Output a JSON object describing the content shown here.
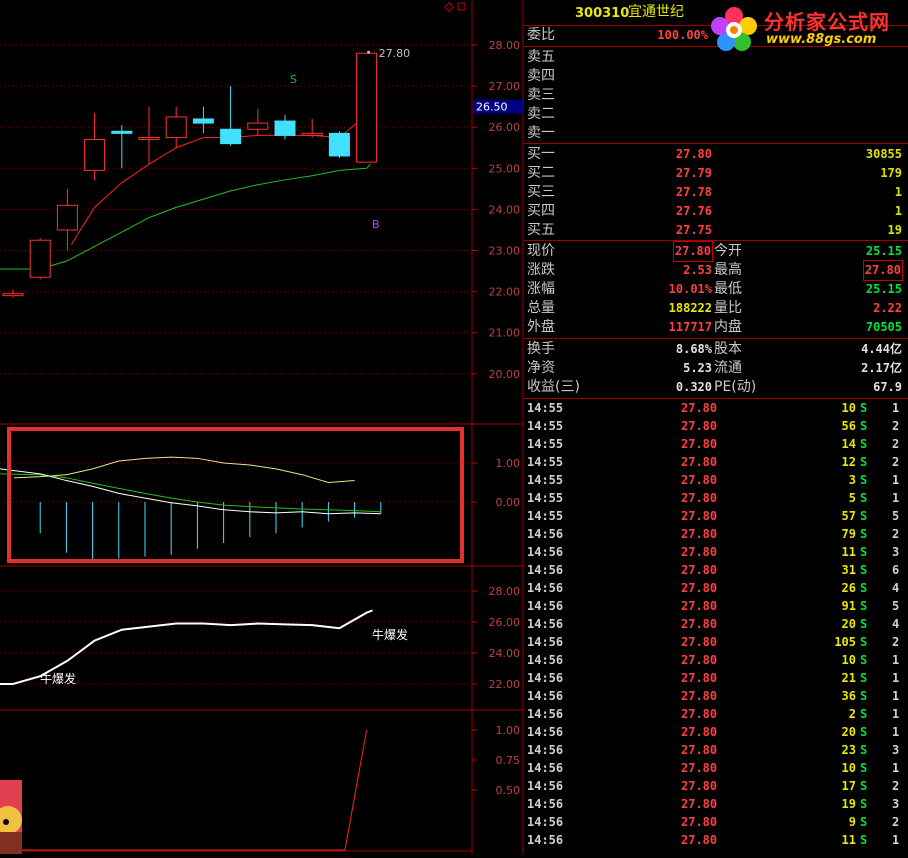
{
  "header": {
    "stock_code": "300310",
    "stock_name": "宜通世纪"
  },
  "logo": {
    "brand": "分析家公式网",
    "url": "www.88gs.com"
  },
  "weibi": {
    "label": "委比",
    "value": "100.00%"
  },
  "sell_orders": [
    {
      "label": "卖五",
      "price": "",
      "vol": ""
    },
    {
      "label": "卖四",
      "price": "",
      "vol": ""
    },
    {
      "label": "卖三",
      "price": "",
      "vol": ""
    },
    {
      "label": "卖二",
      "price": "",
      "vol": ""
    },
    {
      "label": "卖一",
      "price": "",
      "vol": ""
    }
  ],
  "buy_orders": [
    {
      "label": "买一",
      "price": "27.80",
      "vol": "30855"
    },
    {
      "label": "买二",
      "price": "27.79",
      "vol": "179"
    },
    {
      "label": "买三",
      "price": "27.78",
      "vol": "1"
    },
    {
      "label": "买四",
      "price": "27.76",
      "vol": "1"
    },
    {
      "label": "买五",
      "price": "27.75",
      "vol": "19"
    }
  ],
  "stats": [
    {
      "l1": "现价",
      "v1": "27.80",
      "c1": "red",
      "b1": true,
      "l2": "今开",
      "v2": "25.15",
      "c2": "green",
      "b2": false
    },
    {
      "l1": "涨跌",
      "v1": "2.53",
      "c1": "red",
      "b1": false,
      "l2": "最高",
      "v2": "27.80",
      "c2": "red",
      "b2": true
    },
    {
      "l1": "涨幅",
      "v1": "10.01%",
      "c1": "red",
      "b1": false,
      "l2": "最低",
      "v2": "25.15",
      "c2": "green",
      "b2": false
    },
    {
      "l1": "总量",
      "v1": "188222",
      "c1": "yellow",
      "b1": false,
      "l2": "量比",
      "v2": "2.22",
      "c2": "red",
      "b2": false
    },
    {
      "l1": "外盘",
      "v1": "117717",
      "c1": "red",
      "b1": false,
      "l2": "内盘",
      "v2": "70505",
      "c2": "green",
      "b2": false
    }
  ],
  "stats2": [
    {
      "l1": "换手",
      "v1": "8.68%",
      "l2": "股本",
      "v2": "4.44亿"
    },
    {
      "l1": "净资",
      "v1": "5.23",
      "l2": "流通",
      "v2": "2.17亿"
    },
    {
      "l1": "收益(三)",
      "v1": "0.320",
      "l2": "PE(动)",
      "v2": "67.9"
    }
  ],
  "ticks": [
    {
      "time": "14:55",
      "price": "27.80",
      "vol": "10",
      "side": "S",
      "cnt": "1"
    },
    {
      "time": "14:55",
      "price": "27.80",
      "vol": "56",
      "side": "S",
      "cnt": "2"
    },
    {
      "time": "14:55",
      "price": "27.80",
      "vol": "14",
      "side": "S",
      "cnt": "2"
    },
    {
      "time": "14:55",
      "price": "27.80",
      "vol": "12",
      "side": "S",
      "cnt": "2"
    },
    {
      "time": "14:55",
      "price": "27.80",
      "vol": "3",
      "side": "S",
      "cnt": "1"
    },
    {
      "time": "14:55",
      "price": "27.80",
      "vol": "5",
      "side": "S",
      "cnt": "1"
    },
    {
      "time": "14:55",
      "price": "27.80",
      "vol": "57",
      "side": "S",
      "cnt": "5"
    },
    {
      "time": "14:56",
      "price": "27.80",
      "vol": "79",
      "side": "S",
      "cnt": "2"
    },
    {
      "time": "14:56",
      "price": "27.80",
      "vol": "11",
      "side": "S",
      "cnt": "3"
    },
    {
      "time": "14:56",
      "price": "27.80",
      "vol": "31",
      "side": "S",
      "cnt": "6"
    },
    {
      "time": "14:56",
      "price": "27.80",
      "vol": "26",
      "side": "S",
      "cnt": "4"
    },
    {
      "time": "14:56",
      "price": "27.80",
      "vol": "91",
      "side": "S",
      "cnt": "5"
    },
    {
      "time": "14:56",
      "price": "27.80",
      "vol": "20",
      "side": "S",
      "cnt": "4"
    },
    {
      "time": "14:56",
      "price": "27.80",
      "vol": "105",
      "side": "S",
      "cnt": "2"
    },
    {
      "time": "14:56",
      "price": "27.80",
      "vol": "10",
      "side": "S",
      "cnt": "1"
    },
    {
      "time": "14:56",
      "price": "27.80",
      "vol": "21",
      "side": "S",
      "cnt": "1"
    },
    {
      "time": "14:56",
      "price": "27.80",
      "vol": "36",
      "side": "S",
      "cnt": "1"
    },
    {
      "time": "14:56",
      "price": "27.80",
      "vol": "2",
      "side": "S",
      "cnt": "1"
    },
    {
      "time": "14:56",
      "price": "27.80",
      "vol": "20",
      "side": "S",
      "cnt": "1"
    },
    {
      "time": "14:56",
      "price": "27.80",
      "vol": "23",
      "side": "S",
      "cnt": "3"
    },
    {
      "time": "14:56",
      "price": "27.80",
      "vol": "10",
      "side": "S",
      "cnt": "1"
    },
    {
      "time": "14:56",
      "price": "27.80",
      "vol": "17",
      "side": "S",
      "cnt": "2"
    },
    {
      "time": "14:56",
      "price": "27.80",
      "vol": "19",
      "side": "S",
      "cnt": "3"
    },
    {
      "time": "14:56",
      "price": "27.80",
      "vol": "9",
      "side": "S",
      "cnt": "2"
    },
    {
      "time": "14:56",
      "price": "27.80",
      "vol": "11",
      "side": "S",
      "cnt": "1"
    }
  ],
  "main_chart": {
    "y_ticks": [
      "28.00",
      "27.00",
      "26.00",
      "25.00",
      "24.00",
      "23.00",
      "22.00",
      "21.00",
      "20.00"
    ],
    "current_price_tag": "26.50",
    "high_label": "27.80",
    "signal_s": "S",
    "signal_b": "B",
    "candles": [
      {
        "o": 21.95,
        "h": 22.05,
        "l": 21.85,
        "c": 21.95
      },
      {
        "o": 22.35,
        "h": 23.3,
        "l": 22.3,
        "c": 23.25
      },
      {
        "o": 23.5,
        "h": 24.5,
        "l": 23.0,
        "c": 24.1
      },
      {
        "o": 24.95,
        "h": 26.35,
        "l": 24.7,
        "c": 25.7
      },
      {
        "o": 25.9,
        "h": 26.05,
        "l": 25.0,
        "c": 25.85
      },
      {
        "o": 25.75,
        "h": 26.5,
        "l": 25.1,
        "c": 25.75
      },
      {
        "o": 25.75,
        "h": 26.5,
        "l": 25.5,
        "c": 26.25
      },
      {
        "o": 26.2,
        "h": 26.5,
        "l": 25.85,
        "c": 26.1
      },
      {
        "o": 25.95,
        "h": 27.0,
        "l": 25.55,
        "c": 25.6
      },
      {
        "o": 25.95,
        "h": 26.45,
        "l": 25.8,
        "c": 26.1
      },
      {
        "o": 26.15,
        "h": 26.3,
        "l": 25.7,
        "c": 25.8
      },
      {
        "o": 25.85,
        "h": 26.2,
        "l": 25.75,
        "c": 25.85
      },
      {
        "o": 25.85,
        "h": 25.9,
        "l": 25.25,
        "c": 25.3
      },
      {
        "o": 25.15,
        "h": 27.8,
        "l": 25.15,
        "c": 27.8
      }
    ],
    "ma_red": [
      null,
      null,
      null,
      24.05,
      24.65,
      25.1,
      25.5,
      25.75,
      25.75,
      25.8,
      25.8,
      25.8,
      25.75,
      26.3
    ],
    "ma_green": [
      22.55,
      22.55,
      22.75,
      23.1,
      23.45,
      23.8,
      24.05,
      24.25,
      24.45,
      24.6,
      24.72,
      24.82,
      24.95,
      25.0
    ]
  },
  "macd_chart": {
    "y_ticks": [
      "1.00",
      "0.00"
    ],
    "dif": [
      0.85,
      0.72,
      0.55,
      0.4,
      0.22,
      0.1,
      -0.02,
      -0.1,
      -0.2,
      -0.25,
      -0.28,
      -0.25,
      -0.3,
      -0.28,
      -0.3
    ],
    "dea": [
      0.62,
      0.65,
      0.7,
      0.85,
      1.05,
      1.12,
      1.15,
      1.12,
      1.0,
      0.95,
      0.85,
      0.7,
      0.5,
      0.55
    ],
    "gline": [
      0.72,
      0.7,
      0.62,
      0.48,
      0.35,
      0.22,
      0.1,
      0.0,
      -0.08,
      -0.12,
      -0.15,
      -0.18,
      -0.2,
      -0.22,
      -0.25
    ],
    "bars": [
      -0.5,
      -0.8,
      -1.3,
      -1.5,
      -1.45,
      -1.4,
      -1.35,
      -1.2,
      -1.05,
      -0.9,
      -0.8,
      -0.65,
      -0.5,
      -0.4,
      -0.3
    ]
  },
  "sub_chart": {
    "y_ticks": [
      "28.00",
      "26.00",
      "24.00",
      "22.00"
    ],
    "line": [
      22.0,
      22.5,
      23.5,
      24.8,
      25.5,
      25.7,
      25.9,
      25.9,
      25.8,
      25.9,
      25.85,
      25.8,
      25.6,
      26.6
    ],
    "label1": "牛爆发",
    "label2": "牛爆发"
  },
  "bottom_chart": {
    "y_ticks": [
      "1.00",
      "0.75",
      "0.50"
    ],
    "line": [
      0,
      0,
      0,
      0,
      0,
      0,
      0,
      0,
      0,
      0,
      0,
      0,
      0,
      1.0
    ]
  }
}
